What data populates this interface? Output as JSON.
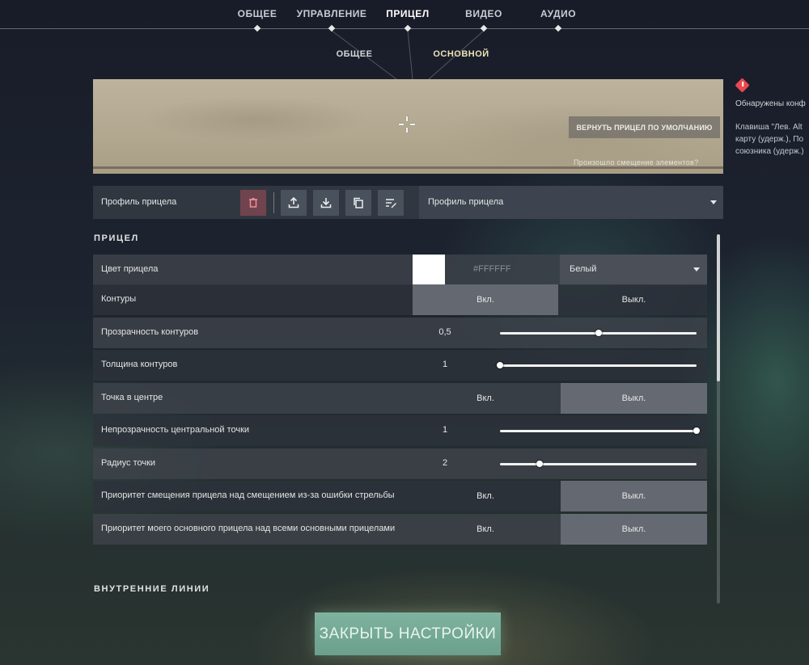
{
  "nav": {
    "tabs": [
      {
        "label": "ОБЩЕЕ",
        "active": false
      },
      {
        "label": "УПРАВЛЕНИЕ",
        "active": false
      },
      {
        "label": "ПРИЦЕЛ",
        "active": true
      },
      {
        "label": "ВИДЕО",
        "active": false
      },
      {
        "label": "АУДИО",
        "active": false
      }
    ],
    "subtabs": [
      {
        "label": "ОБЩЕЕ",
        "active": false
      },
      {
        "label": "ОСНОВНОЙ",
        "active": true
      }
    ]
  },
  "preview": {
    "reset_label": "ВЕРНУТЬ ПРИЦЕЛ ПО УМОЛЧАНИЮ",
    "shift_link": "Произошло смещение элементов?"
  },
  "notice": {
    "title": "Обнаружены конф",
    "lines": [
      "Клавиша \"Лев. Alt",
      "карту (удерж.), По",
      "союзника (удерж.)"
    ]
  },
  "profile": {
    "label": "Профиль прицела",
    "select_value": "Профиль прицела",
    "actions": [
      "delete-icon",
      "upload-icon",
      "download-icon",
      "copy-icon",
      "rename-icon"
    ]
  },
  "sections": {
    "crosshair": "ПРИЦЕЛ",
    "inner_lines": "ВНУТРЕННИЕ ЛИНИИ"
  },
  "settings": {
    "color": {
      "label": "Цвет прицела",
      "hex": "#FFFFFF",
      "value": "Белый",
      "swatch": "#ffffff"
    },
    "outlines": {
      "label": "Контуры",
      "on": "Вкл.",
      "off": "Выкл.",
      "selected": "on"
    },
    "outline_opacity": {
      "label": "Прозрачность контуров",
      "value": "0,5",
      "fraction": 0.5
    },
    "outline_thickness": {
      "label": "Толщина контуров",
      "value": "1",
      "fraction": 0.0
    },
    "center_dot": {
      "label": "Точка в центре",
      "on": "Вкл.",
      "off": "Выкл.",
      "selected": "off"
    },
    "center_dot_opacity": {
      "label": "Непрозрачность центральной точки",
      "value": "1",
      "fraction": 1.0
    },
    "dot_radius": {
      "label": "Радиус точки",
      "value": "2",
      "fraction": 0.2
    },
    "shift_priority": {
      "label": "Приоритет смещения прицела над смещением из-за ошибки стрельбы",
      "on": "Вкл.",
      "off": "Выкл.",
      "selected": "off"
    },
    "primary_priority": {
      "label": "Приоритет моего основного прицела над всеми основными прицелами",
      "on": "Вкл.",
      "off": "Выкл.",
      "selected": "off"
    }
  },
  "close_label": "ЗАКРЫТЬ НАСТРОЙКИ",
  "colors": {
    "accent": "#6fa592",
    "active_subtab": "#ede3b8",
    "warning": "#e8484f"
  }
}
